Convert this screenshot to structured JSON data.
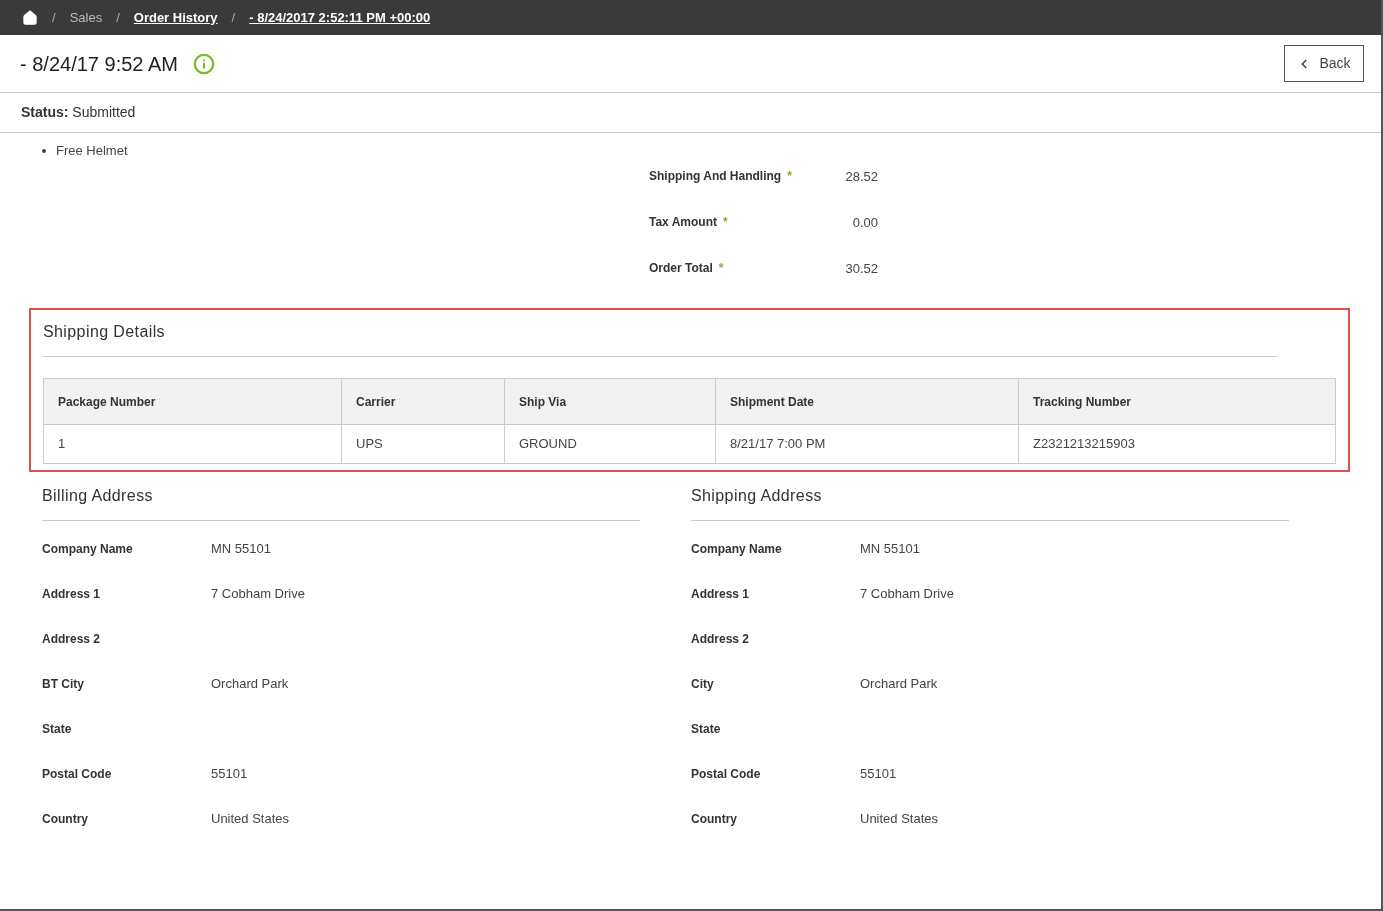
{
  "breadcrumb": {
    "items": [
      {
        "label": "Sales",
        "link": false
      },
      {
        "label": "Order History",
        "link": true
      },
      {
        "label": "- 8/24/2017 2:52:11 PM +00:00",
        "link": true
      }
    ],
    "separator": "/"
  },
  "title": "- 8/24/17 9:52 AM",
  "back_button": "Back",
  "status": {
    "label": "Status:",
    "value": "Submitted"
  },
  "promotions": [
    "Free Helmet"
  ],
  "totals": [
    {
      "label": "Shipping And Handling",
      "marker": "*",
      "value": "28.52"
    },
    {
      "label": "Tax Amount",
      "marker": "*",
      "value": "0.00"
    },
    {
      "label": "Order Total",
      "marker": "*",
      "value": "30.52"
    }
  ],
  "shipping_details": {
    "title": "Shipping Details",
    "highlighted": true,
    "columns": [
      "Package Number",
      "Carrier",
      "Ship Via",
      "Shipment Date",
      "Tracking Number"
    ],
    "rows": [
      [
        "1",
        "UPS",
        "GROUND",
        "8/21/17 7:00 PM",
        "Z2321213215903"
      ]
    ]
  },
  "addresses": [
    {
      "title": "Billing Address",
      "fields": [
        {
          "label": "Company Name",
          "value": "MN 55101"
        },
        {
          "label": "Address 1",
          "value": "7 Cobham Drive"
        },
        {
          "label": "Address 2"
        },
        {
          "label": "BT City",
          "value": "Orchard Park"
        },
        {
          "label": "State"
        },
        {
          "label": "Postal Code",
          "value": "55101"
        },
        {
          "label": "Country",
          "value": "United States"
        }
      ]
    },
    {
      "title": "Shipping Address",
      "fields": [
        {
          "label": "Company Name",
          "value": "MN 55101"
        },
        {
          "label": "Address 1",
          "value": "7 Cobham Drive"
        },
        {
          "label": "Address 2"
        },
        {
          "label": "City",
          "value": "Orchard Park"
        },
        {
          "label": "State"
        },
        {
          "label": "Postal Code",
          "value": "55101"
        },
        {
          "label": "Country",
          "value": "United States"
        }
      ]
    }
  ]
}
